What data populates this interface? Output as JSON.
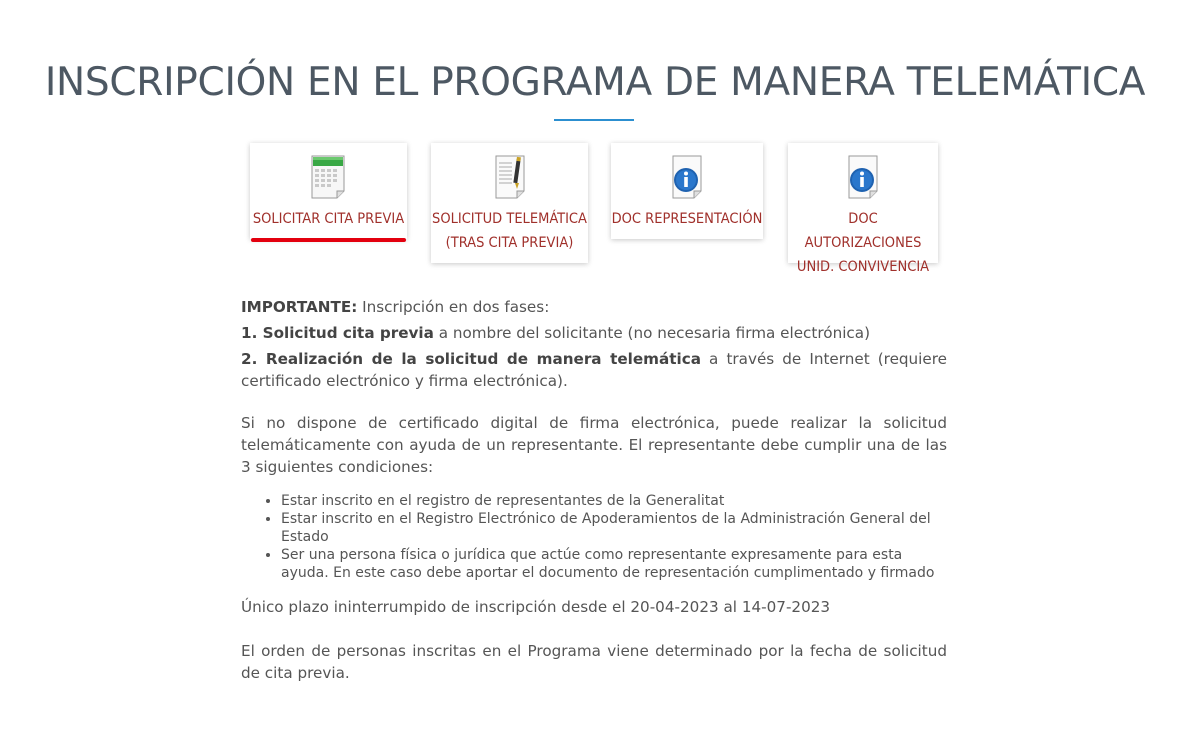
{
  "page": {
    "title": "INSCRIPCIÓN EN EL PROGRAMA DE MANERA TELEMÁTICA"
  },
  "cards": [
    {
      "icon": "calendar-icon",
      "lines": [
        "SOLICITAR CITA PREVIA"
      ],
      "active": true
    },
    {
      "icon": "signed-document-icon",
      "lines": [
        "SOLICITUD TELEMÁTICA",
        "(TRAS CITA PREVIA)"
      ],
      "active": false
    },
    {
      "icon": "info-document-icon",
      "lines": [
        "DOC REPRESENTACIÓN"
      ],
      "active": false
    },
    {
      "icon": "info-document-icon",
      "lines": [
        "DOC AUTORIZACIONES",
        "UNID. CONVIVENCIA"
      ],
      "active": false
    }
  ],
  "colors": {
    "title": "#4d5863",
    "title_rule": "#2c8fd0",
    "card_label": "#a0302b",
    "active_underline": "#e3000f",
    "body_text": "#555555"
  },
  "content": {
    "importante_label": "IMPORTANTE:",
    "importante_text": " Inscripción en dos fases:",
    "fase1_bold": "1. Solicitud cita previa",
    "fase1_text": " a nombre del solicitante (no necesaria firma electrónica)",
    "fase2_bold": "2. Realización de la solicitud de manera telemática",
    "fase2_text": " a través de Internet (requiere certificado electrónico y firma electrónica).",
    "representante_text": "Si no dispone de certificado digital de firma electrónica, puede realizar la solicitud telemáticamente con ayuda de un representante. El representante debe cumplir una de las 3 siguientes condiciones:",
    "condiciones": [
      "Estar inscrito en el registro de representantes de la Generalitat",
      "Estar inscrito en el Registro Electrónico de Apoderamientos de la Administración General del Estado",
      "Ser una persona física o jurídica que actúe como representante expresamente para esta ayuda. En este caso debe aportar el documento de representación cumplimentado y firmado"
    ],
    "plazo_text": "Único plazo ininterrumpido de inscripción desde el 20-04-2023 al 14-07-2023",
    "orden_text": "El orden de personas inscritas en el Programa viene determinado por la fecha de solicitud de cita previa."
  }
}
